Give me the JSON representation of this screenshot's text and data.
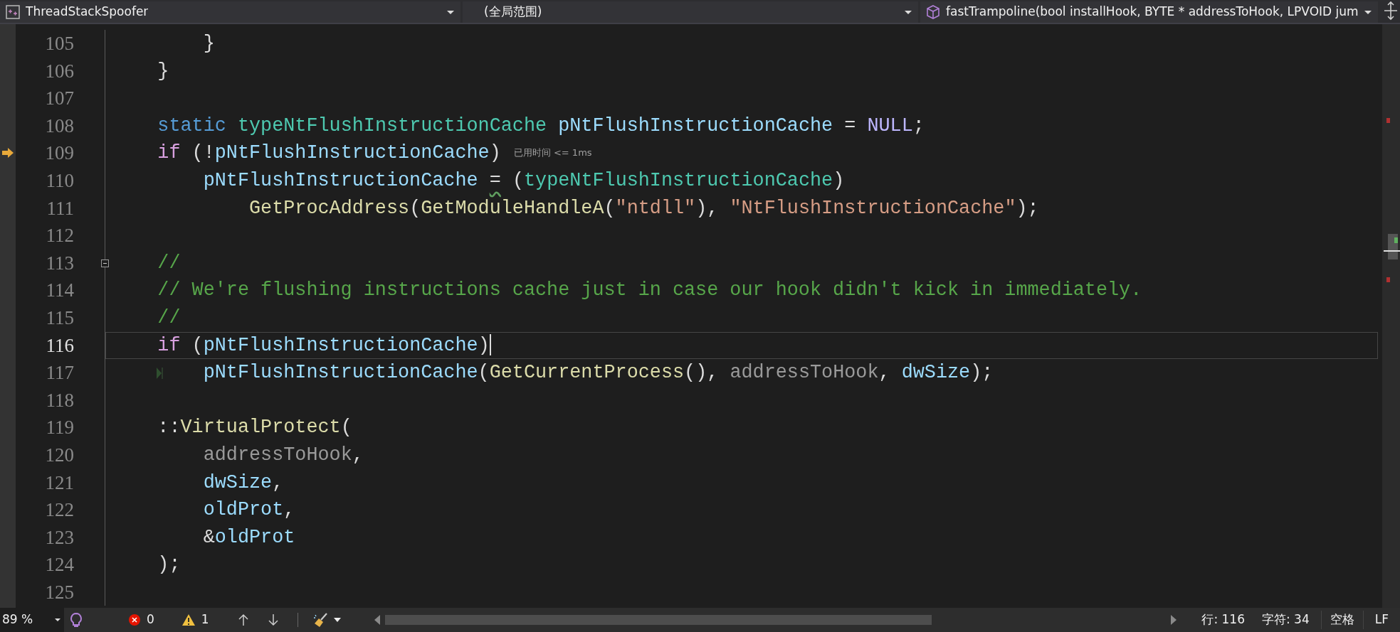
{
  "navigation_bar": {
    "project": "ThreadStackSpoofer",
    "scope": "(全局范围)",
    "member": "fastTrampoline(bool installHook, BYTE * addressToHook, LPVOID jum"
  },
  "editor": {
    "lines": [
      {
        "number": "105",
        "exec": false,
        "current": false,
        "fold": false,
        "hint": false,
        "tokens": [
          {
            "text": "        }",
            "kind": "plain"
          }
        ]
      },
      {
        "number": "106",
        "exec": false,
        "current": false,
        "fold": false,
        "hint": false,
        "tokens": [
          {
            "text": "    }",
            "kind": "plain"
          }
        ]
      },
      {
        "number": "107",
        "exec": false,
        "current": false,
        "fold": false,
        "hint": false
      },
      {
        "number": "108",
        "exec": false,
        "current": false,
        "fold": false,
        "hint": false,
        "tokens": [
          {
            "text": "    static ",
            "kind": "keyword"
          },
          {
            "text": "typeNtFlushInstructionCache ",
            "kind": "type"
          },
          {
            "text": "pNtFlushInstructionCache",
            "kind": "var"
          },
          {
            "text": " = ",
            "kind": "plain"
          },
          {
            "text": "NULL",
            "kind": "macro"
          },
          {
            "text": ";",
            "kind": "plain"
          }
        ]
      },
      {
        "number": "109",
        "exec": true,
        "current": false,
        "fold": false,
        "hint": false,
        "tokens": [
          {
            "text": "    if",
            "kind": "control"
          },
          {
            "text": " (!",
            "kind": "plain"
          },
          {
            "text": "pNtFlushInstructionCache",
            "kind": "var"
          },
          {
            "text": ")",
            "kind": "plain"
          },
          {
            "text": "已用时间 <= 1ms",
            "kind": "inlay"
          }
        ]
      },
      {
        "number": "110",
        "exec": false,
        "current": false,
        "fold": false,
        "hint": false,
        "tokens": [
          {
            "text": "        pNtFlushInstructionCache ",
            "kind": "var"
          },
          {
            "text": "=",
            "kind": "warn"
          },
          {
            "text": " (",
            "kind": "plain"
          },
          {
            "text": "typeNtFlushInstructionCache",
            "kind": "type"
          },
          {
            "text": ")",
            "kind": "plain"
          }
        ]
      },
      {
        "number": "111",
        "exec": false,
        "current": false,
        "fold": false,
        "hint": false,
        "tokens": [
          {
            "text": "            GetProcAddress",
            "kind": "func"
          },
          {
            "text": "(",
            "kind": "plain"
          },
          {
            "text": "GetModuleHandleA",
            "kind": "func"
          },
          {
            "text": "(",
            "kind": "plain"
          },
          {
            "text": "\"ntdll\"",
            "kind": "string"
          },
          {
            "text": "), ",
            "kind": "plain"
          },
          {
            "text": "\"NtFlushInstructionCache\"",
            "kind": "string"
          },
          {
            "text": ");",
            "kind": "plain"
          }
        ]
      },
      {
        "number": "112",
        "exec": false,
        "current": false,
        "fold": false,
        "hint": false
      },
      {
        "number": "113",
        "exec": false,
        "current": false,
        "fold": true,
        "hint": false,
        "tokens": [
          {
            "text": "    //",
            "kind": "comment"
          }
        ]
      },
      {
        "number": "114",
        "exec": false,
        "current": false,
        "fold": false,
        "hint": false,
        "tokens": [
          {
            "text": "    // We're flushing instructions cache just in case our hook didn't kick in immediately.",
            "kind": "comment"
          }
        ]
      },
      {
        "number": "115",
        "exec": false,
        "current": false,
        "fold": false,
        "hint": false,
        "tokens": [
          {
            "text": "    //",
            "kind": "comment"
          }
        ]
      },
      {
        "number": "116",
        "exec": false,
        "current": true,
        "fold": false,
        "hint": false,
        "tokens": [
          {
            "text": "    if",
            "kind": "control"
          },
          {
            "text": " (",
            "kind": "plain"
          },
          {
            "text": "pNtFlushInstructionCache",
            "kind": "var"
          },
          {
            "text": ")",
            "kind": "plain"
          }
        ]
      },
      {
        "number": "117",
        "exec": false,
        "current": false,
        "fold": false,
        "hint": true,
        "tokens": [
          {
            "text": "        pNtFlushInstructionCache",
            "kind": "var"
          },
          {
            "text": "(",
            "kind": "plain"
          },
          {
            "text": "GetCurrentProcess",
            "kind": "func"
          },
          {
            "text": "(), ",
            "kind": "plain"
          },
          {
            "text": "addressToHook",
            "kind": "param"
          },
          {
            "text": ", ",
            "kind": "plain"
          },
          {
            "text": "dwSize",
            "kind": "var"
          },
          {
            "text": ");",
            "kind": "plain"
          }
        ]
      },
      {
        "number": "118",
        "exec": false,
        "current": false,
        "fold": false,
        "hint": false
      },
      {
        "number": "119",
        "exec": false,
        "current": false,
        "fold": false,
        "hint": false,
        "tokens": [
          {
            "text": "    ::",
            "kind": "plain"
          },
          {
            "text": "VirtualProtect",
            "kind": "func"
          },
          {
            "text": "(",
            "kind": "plain"
          }
        ]
      },
      {
        "number": "120",
        "exec": false,
        "current": false,
        "fold": false,
        "hint": false,
        "tokens": [
          {
            "text": "        addressToHook",
            "kind": "param"
          },
          {
            "text": ",",
            "kind": "plain"
          }
        ]
      },
      {
        "number": "121",
        "exec": false,
        "current": false,
        "fold": false,
        "hint": false,
        "tokens": [
          {
            "text": "        dwSize",
            "kind": "var"
          },
          {
            "text": ",",
            "kind": "plain"
          }
        ]
      },
      {
        "number": "122",
        "exec": false,
        "current": false,
        "fold": false,
        "hint": false,
        "tokens": [
          {
            "text": "        oldProt",
            "kind": "var"
          },
          {
            "text": ",",
            "kind": "plain"
          }
        ]
      },
      {
        "number": "123",
        "exec": false,
        "current": false,
        "fold": false,
        "hint": false,
        "tokens": [
          {
            "text": "        &",
            "kind": "plain"
          },
          {
            "text": "oldProt",
            "kind": "var"
          }
        ]
      },
      {
        "number": "124",
        "exec": false,
        "current": false,
        "fold": false,
        "hint": false,
        "tokens": [
          {
            "text": "    );",
            "kind": "plain"
          }
        ]
      },
      {
        "number": "125",
        "exec": false,
        "current": false,
        "fold": false,
        "hint": false
      }
    ]
  },
  "status_bar": {
    "zoom": "89 %",
    "errors": "0",
    "warnings": "1",
    "line": "行: 116",
    "column": "字符: 34",
    "indentation": "空格",
    "line_ending": "LF"
  }
}
